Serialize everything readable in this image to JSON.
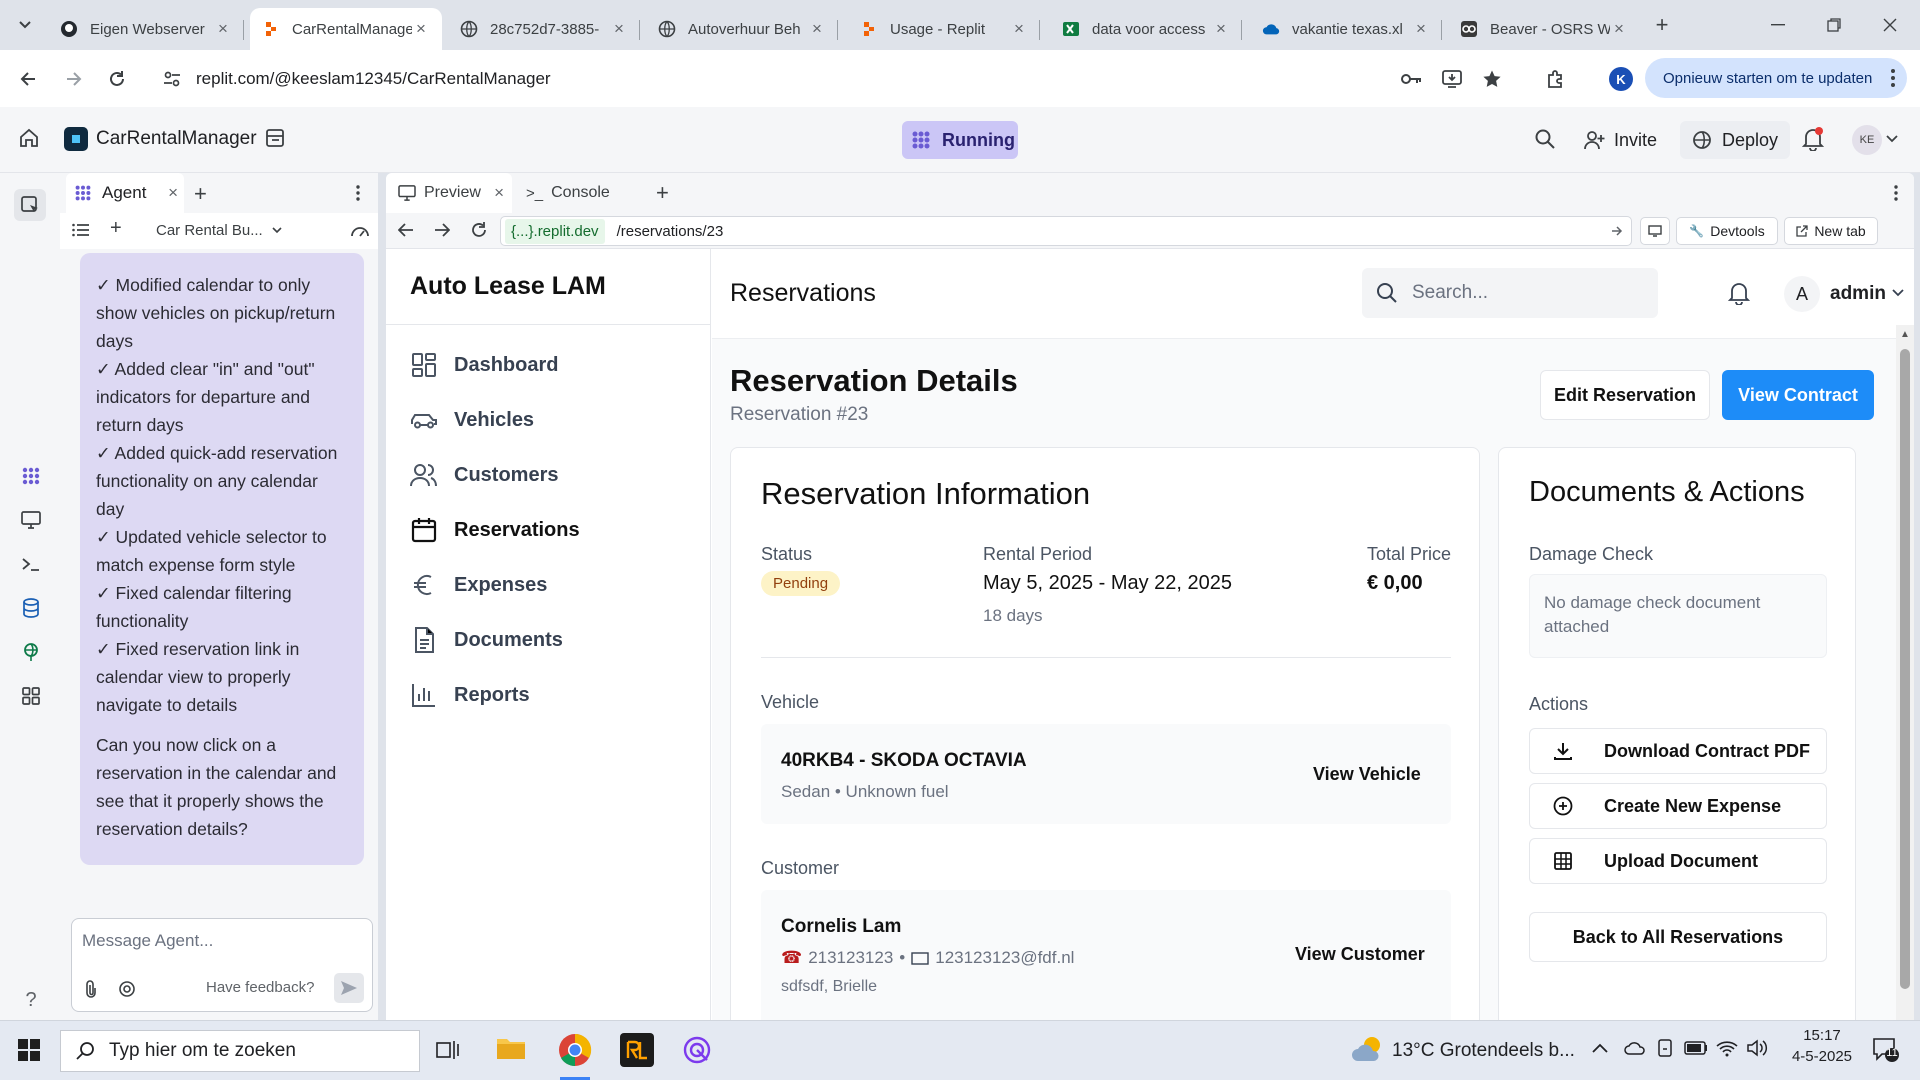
{
  "browser": {
    "tabs": [
      {
        "title": "Eigen Webserver",
        "icon": "github-icon"
      },
      {
        "title": "CarRentalManager",
        "icon": "replit-icon"
      },
      {
        "title": "28c752d7-3885-",
        "icon": "globe-icon"
      },
      {
        "title": "Autoverhuur Beh",
        "icon": "globe-icon"
      },
      {
        "title": "Usage - Replit",
        "icon": "replit-icon"
      },
      {
        "title": "data voor access",
        "icon": "excel-icon"
      },
      {
        "title": "vakantie texas.xl",
        "icon": "onedrive-icon"
      },
      {
        "title": "Beaver - OSRS W",
        "icon": "osrs-icon"
      }
    ],
    "url": "replit.com/@keeslam12345/CarRentalManager",
    "profile_initial": "K",
    "update_label": "Opnieuw starten om te updaten"
  },
  "replit": {
    "project_name": "CarRentalManager",
    "status": "Running",
    "invite_label": "Invite",
    "deploy_label": "Deploy",
    "avatar_initials": "KE",
    "agent_tab": "Agent",
    "thread_title": "Car Rental Bu...",
    "agent_messages": [
      "✓ Modified calendar to only show vehicles on pickup/return days",
      "✓ Added clear \"in\" and \"out\" indicators for departure and return days",
      "✓ Added quick-add reservation functionality on any calendar day",
      "✓ Updated vehicle selector to match expense form style",
      "✓ Fixed calendar filtering functionality",
      "✓ Fixed reservation link in calendar view to properly navigate to details"
    ],
    "agent_question": "Can you now click on a reservation in the calendar and see that it properly shows the reservation details?",
    "message_placeholder": "Message Agent...",
    "feedback_label": "Have feedback?",
    "preview_tab": "Preview",
    "console_tab": "Console",
    "preview_domain": "{...}.replit.dev",
    "preview_path": "/reservations/23",
    "devtools_label": "Devtools",
    "newtab_label": "New tab"
  },
  "app": {
    "brand": "Auto Lease LAM",
    "nav": [
      {
        "label": "Dashboard",
        "icon": "dashboard-icon"
      },
      {
        "label": "Vehicles",
        "icon": "car-icon"
      },
      {
        "label": "Customers",
        "icon": "users-icon"
      },
      {
        "label": "Reservations",
        "icon": "calendar-icon"
      },
      {
        "label": "Expenses",
        "icon": "euro-icon"
      },
      {
        "label": "Documents",
        "icon": "document-icon"
      },
      {
        "label": "Reports",
        "icon": "chart-icon"
      }
    ],
    "active_nav": "Reservations",
    "page_title": "Reservations",
    "search_placeholder": "Search...",
    "user_initial": "A",
    "user_name": "admin",
    "heading": "Reservation Details",
    "subheading": "Reservation #23",
    "edit_button": "Edit Reservation",
    "contract_button": "View Contract",
    "info": {
      "title": "Reservation Information",
      "status_label": "Status",
      "status_value": "Pending",
      "period_label": "Rental Period",
      "period_value": "May 5, 2025 - May 22, 2025",
      "period_days": "18 days",
      "price_label": "Total Price",
      "price_value": "€ 0,00",
      "vehicle_label": "Vehicle",
      "vehicle_name": "40RKB4 - SKODA OCTAVIA",
      "vehicle_details": "Sedan • Unknown fuel",
      "view_vehicle": "View Vehicle",
      "customer_label": "Customer",
      "customer_name": "Cornelis Lam",
      "customer_phone": "213123123",
      "customer_email": "123123123@fdf.nl",
      "customer_address": "sdfsdf, Brielle",
      "view_customer": "View Customer"
    },
    "docs": {
      "title": "Documents & Actions",
      "damage_label": "Damage Check",
      "damage_empty": "No damage check document attached",
      "actions_label": "Actions",
      "actions": [
        {
          "label": "Download Contract PDF",
          "icon": "download-icon"
        },
        {
          "label": "Create New Expense",
          "icon": "plus-circle-icon"
        },
        {
          "label": "Upload Document",
          "icon": "table-icon"
        }
      ],
      "back_button": "Back to All Reservations"
    },
    "colors": {
      "primary": "#1d8cf8",
      "pending_bg": "#fdf3c7",
      "pending_text": "#92400e"
    }
  },
  "taskbar": {
    "search_placeholder": "Typ hier om te zoeken",
    "weather": "13°C  Grotendeels b...",
    "time": "15:17",
    "date": "4-5-2025",
    "notifications": "11"
  }
}
